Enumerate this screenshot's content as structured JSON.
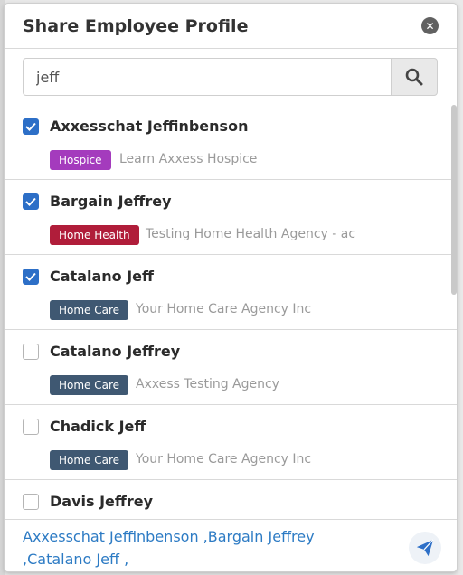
{
  "modal": {
    "title": "Share Employee Profile",
    "close_icon": "close-circle-icon"
  },
  "search": {
    "value": "jeff",
    "icon": "search-icon"
  },
  "employees": [
    {
      "name": "Axxesschat Jeffinbenson",
      "checked": true,
      "badge": "Hospice",
      "badge_color": "#a43bbd",
      "agency": "Learn Axxess Hospice"
    },
    {
      "name": "Bargain Jeffrey",
      "checked": true,
      "badge": "Home Health",
      "badge_color": "#b01d3a",
      "agency": "Testing Home Health Agency - ac"
    },
    {
      "name": "Catalano Jeff",
      "checked": true,
      "badge": "Home Care",
      "badge_color": "#3f5872",
      "agency": "Your Home Care Agency Inc"
    },
    {
      "name": "Catalano Jeffrey",
      "checked": false,
      "badge": "Home Care",
      "badge_color": "#3f5872",
      "agency": "Axxess Testing Agency"
    },
    {
      "name": "Chadick Jeff",
      "checked": false,
      "badge": "Home Care",
      "badge_color": "#3f5872",
      "agency": "Your Home Care Agency Inc"
    },
    {
      "name": "Davis Jeffrey",
      "checked": false
    }
  ],
  "footer": {
    "selected_line1": "Axxesschat Jeffinbenson ,Bargain Jeffrey",
    "selected_line2": ",Catalano Jeff ,",
    "send_icon": "paper-plane-icon"
  },
  "colors": {
    "accent": "#2d6fc7",
    "link": "#2d7bc4"
  }
}
